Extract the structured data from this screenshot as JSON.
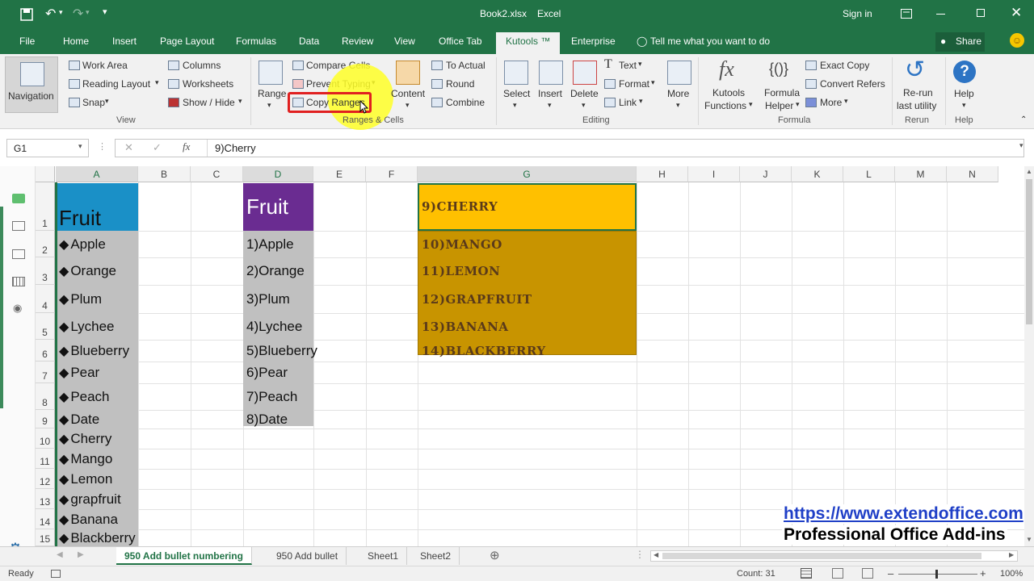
{
  "title_bar": {
    "filename": "Book2.xlsx",
    "app": "Excel",
    "sign_in": "Sign in"
  },
  "tabs": [
    "File",
    "Home",
    "Insert",
    "Page Layout",
    "Formulas",
    "Data",
    "Review",
    "View",
    "Office Tab",
    "Kutools ™",
    "Enterprise"
  ],
  "active_tab": "Kutools ™",
  "tell_me": "Tell me what you want to do",
  "share": "Share",
  "ribbon": {
    "navigation": "Navigation",
    "view_items": [
      "Work Area",
      "Reading Layout",
      "Snap",
      "Columns",
      "Worksheets",
      "Show / Hide"
    ],
    "view_group": "View",
    "range": "Range",
    "ranges_items": [
      "Compare Cells",
      "Prevent Typing",
      "Copy Ranges"
    ],
    "content": "Content",
    "ranges_items2": [
      "To Actual",
      "Round",
      "Combine"
    ],
    "ranges_group": "Ranges & Cells",
    "editing_buttons": [
      "Select",
      "Insert",
      "Delete"
    ],
    "editing_items": [
      "Text",
      "Format",
      "Link"
    ],
    "more": "More",
    "editing_group": "Editing",
    "kutools_functions": [
      "Kutools",
      "Functions"
    ],
    "formula_helper": [
      "Formula",
      "Helper"
    ],
    "formula_items": [
      "Exact Copy",
      "Convert Refers",
      "More"
    ],
    "formula_group": "Formula",
    "rerun": [
      "Re-run",
      "last utility"
    ],
    "rerun_group": "Rerun",
    "help": "Help",
    "help_group": "Help"
  },
  "name_box": "G1",
  "formula_value": "9)Cherry",
  "columns": [
    "A",
    "B",
    "C",
    "D",
    "E",
    "F",
    "G",
    "H",
    "I",
    "J",
    "K",
    "L",
    "M",
    "N"
  ],
  "rows": [
    "1",
    "2",
    "3",
    "4",
    "5",
    "6",
    "7",
    "8",
    "9",
    "10",
    "11",
    "12",
    "13",
    "14",
    "15"
  ],
  "column_a": [
    "Fruit",
    "Apple",
    "Orange",
    "Plum",
    "Lychee",
    "Blueberry",
    "Pear",
    "Peach",
    "Date",
    "Cherry",
    "Mango",
    "Lemon",
    "grapfruit",
    "Banana",
    "Blackberry"
  ],
  "column_d": [
    "Fruit",
    "1)Apple",
    "2)Orange",
    "3)Plum",
    "4)Lychee",
    "5)Blueberry",
    "6)Pear",
    "7)Peach",
    "8)Date"
  ],
  "column_g": [
    "9)CHERRY",
    "10)MANGO",
    "11)LEMON",
    "12)GRAPFRUIT",
    "13)BANANA",
    "14)BLACKBERRY"
  ],
  "watermark": {
    "url": "https://www.extendoffice.com",
    "tagline": "Professional Office Add-ins"
  },
  "sheet_tabs": [
    "950 Add bullet numbering",
    "950 Add bullet",
    "Sheet1",
    "Sheet2"
  ],
  "status": {
    "ready": "Ready",
    "count": "Count: 31",
    "zoom": "100%"
  },
  "colors": {
    "excel_green": "#217346",
    "header_a": "#1a90c7",
    "header_d": "#6a2c91",
    "g1_fill": "#ffc000",
    "g_fill": "#c89400",
    "highlight_ring": "#ffff33",
    "annotation_red": "#e02020"
  }
}
